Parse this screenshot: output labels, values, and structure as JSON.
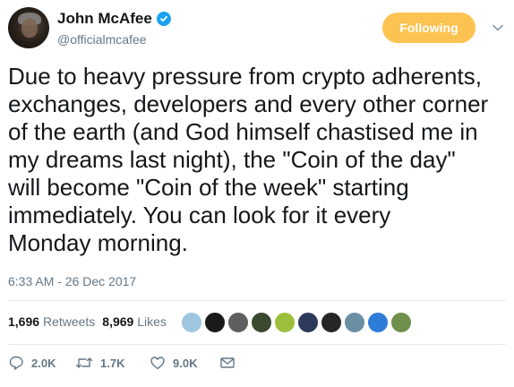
{
  "author": {
    "display_name": "John McAfee",
    "handle": "@officialmcafee",
    "verified_icon": "verified-badge-icon"
  },
  "follow_button": {
    "label": "Following",
    "color": "#fdc352"
  },
  "tweet": {
    "text": "Due to heavy pressure from crypto adherents,\nexchanges, developers and every other corner\nof the earth (and God himself chastised me in\nmy dreams last night), the \"Coin of the day\"\nwill become \"Coin of the week\" starting\nimmediately. You can look for it every\nMonday morning.",
    "timestamp": "6:33 AM - 26 Dec 2017"
  },
  "stats": {
    "retweets_count": "1,696",
    "retweets_label": "Retweets",
    "likes_count": "8,969",
    "likes_label": "Likes"
  },
  "liker_avatars": [
    {
      "color": "#9fc6e0"
    },
    {
      "color": "#1a1a1a"
    },
    {
      "color": "#5f5f5f"
    },
    {
      "color": "#3b4a2e"
    },
    {
      "color": "#9bbf3a"
    },
    {
      "color": "#2d3a5c"
    },
    {
      "color": "#262626"
    },
    {
      "color": "#6c8ea3"
    },
    {
      "color": "#2f7bd8"
    },
    {
      "color": "#6f8f4d"
    }
  ],
  "actions": {
    "reply_count": "2.0K",
    "retweet_count": "1.7K",
    "like_count": "9.0K"
  },
  "colors": {
    "text_primary": "#14171a",
    "text_secondary": "#657786",
    "divider": "#e6ecf0",
    "verified_blue": "#1da1f2"
  }
}
